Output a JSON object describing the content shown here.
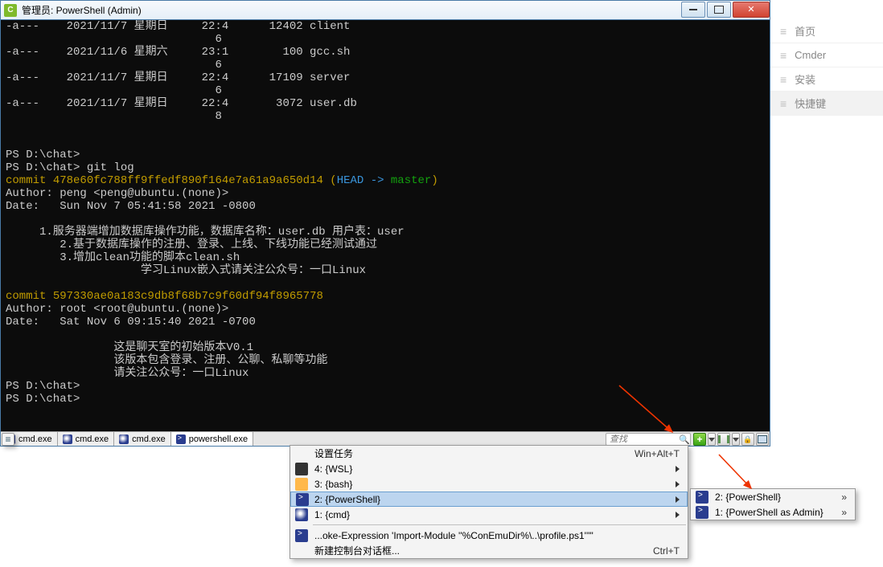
{
  "titlebar": {
    "title": "管理员: PowerShell (Admin)"
  },
  "terminal": {
    "line1a": "-a---    2021/11/7 星期日     22:4      12402 client",
    "line1b": "                               6",
    "line2a": "-a---    2021/11/6 星期六     23:1        100 gcc.sh",
    "line2b": "                               6",
    "line3a": "-a---    2021/11/7 星期日     22:4      17109 server",
    "line3b": "                               6",
    "line4a": "-a---    2021/11/7 星期日     22:4       3072 user.db",
    "line4b": "                               8",
    "blank1": "",
    "blank2": "",
    "ps1": "PS D:\\chat>",
    "ps2": "PS D:\\chat> git log",
    "c1_commit_pref": "commit ",
    "c1_hash": "478e60fc788ff9ffedf890f164e7a61a9a650d14",
    "c1_sp1": " (",
    "c1_head": "HEAD -> ",
    "c1_master": "master",
    "c1_sp2": ")",
    "c1_author": "Author: peng <peng@ubuntu.(none)>",
    "c1_date": "Date:   Sun Nov 7 05:41:58 2021 -0800",
    "c1_b1": "",
    "c1_m1": "     1.服务器端增加数据库操作功能，数据库名称：user.db 用户表：user",
    "c1_m2": "        2.基于数据库操作的注册、登录、上线、下线功能已经测试通过",
    "c1_m3": "        3.增加clean功能的脚本clean.sh",
    "c1_m4": "                    学习Linux嵌入式请关注公众号：一口Linux",
    "c1_b2": "",
    "c2_commit_pref": "commit ",
    "c2_hash": "597330ae0a183c9db8f68b7c9f60df94f8965778",
    "c2_author": "Author: root <root@ubuntu.(none)>",
    "c2_date": "Date:   Sat Nov 6 09:15:40 2021 -0700",
    "c2_b1": "",
    "c2_m1": "                这是聊天室的初始版本V0.1",
    "c2_m2": "                该版本包含登录、注册、公聊、私聊等功能",
    "c2_m3": "                请关注公众号：一口Linux",
    "ps3": "PS D:\\chat>",
    "ps4": "PS D:\\chat>"
  },
  "tabs": {
    "t1": "cmd.exe",
    "t2": "cmd.exe",
    "t3": "cmd.exe",
    "t4": "powershell.exe"
  },
  "search": {
    "placeholder": "查找"
  },
  "menu": {
    "header": "设置任务",
    "header_sc": "Win+Alt+T",
    "i1": "4: {WSL}",
    "i2": "3: {bash}",
    "i3": "2: {PowerShell}",
    "i4": "1: {cmd}",
    "i5": "...oke-Expression 'Import-Module ''%ConEmuDir%\\..\\profile.ps1'''\"",
    "i6": "新建控制台对话框...",
    "i6_sc": "Ctrl+T"
  },
  "submenu": {
    "s1": "2: {PowerShell}",
    "s2": "1: {PowerShell as Admin}"
  },
  "side": {
    "i1": "首页",
    "i2": "Cmder",
    "i3": "安装",
    "i4": "快捷键"
  }
}
